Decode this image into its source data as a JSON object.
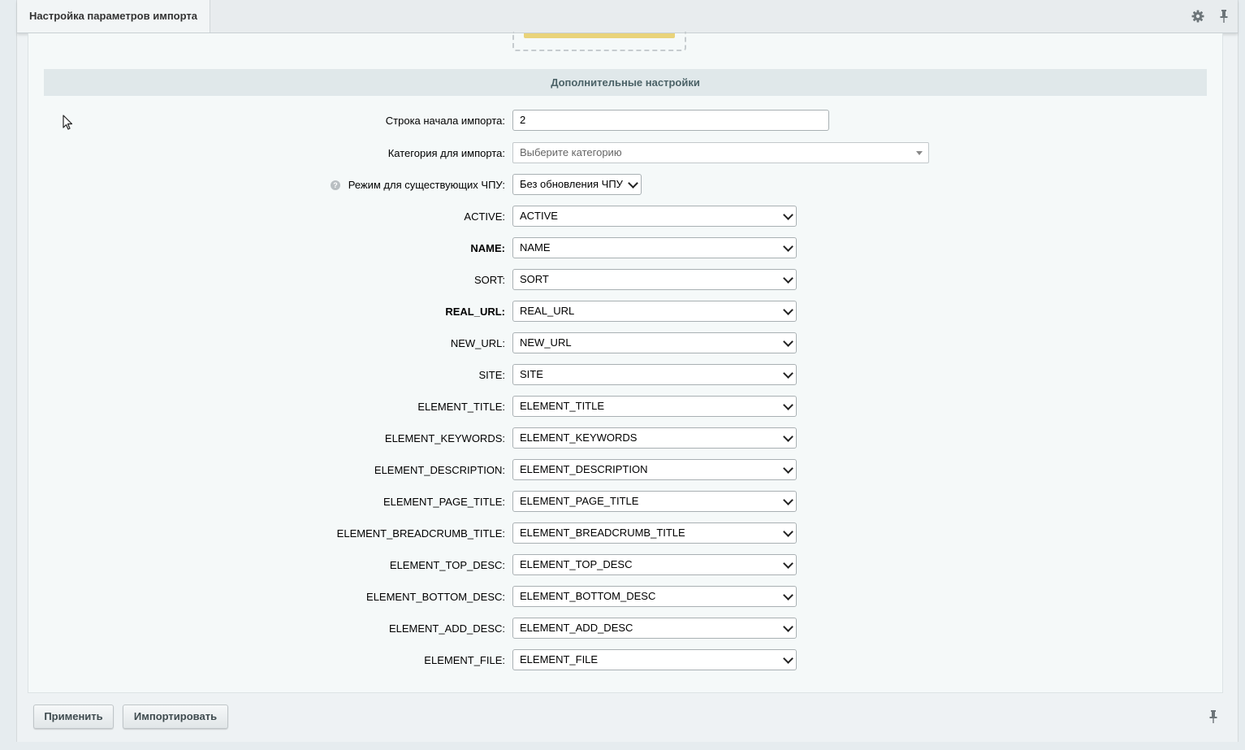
{
  "tab": {
    "title": "Настройка параметров импорта"
  },
  "section": {
    "heading": "Дополнительные настройки"
  },
  "form": {
    "start_row": {
      "label": "Строка начала импорта:",
      "value": "2"
    },
    "category": {
      "label": "Категория для импорта:",
      "placeholder": "Выберите категорию"
    },
    "url_mode": {
      "label": "Режим для существующих ЧПУ:",
      "value": "Без обновления ЧПУ",
      "help_glyph": "?"
    },
    "mappings": [
      {
        "label": "ACTIVE:",
        "value": "ACTIVE",
        "bold": false
      },
      {
        "label": "NAME:",
        "value": "NAME",
        "bold": true
      },
      {
        "label": "SORT:",
        "value": "SORT",
        "bold": false
      },
      {
        "label": "REAL_URL:",
        "value": "REAL_URL",
        "bold": true
      },
      {
        "label": "NEW_URL:",
        "value": "NEW_URL",
        "bold": false
      },
      {
        "label": "SITE:",
        "value": "SITE",
        "bold": false
      },
      {
        "label": "ELEMENT_TITLE:",
        "value": "ELEMENT_TITLE",
        "bold": false
      },
      {
        "label": "ELEMENT_KEYWORDS:",
        "value": "ELEMENT_KEYWORDS",
        "bold": false
      },
      {
        "label": "ELEMENT_DESCRIPTION:",
        "value": "ELEMENT_DESCRIPTION",
        "bold": false
      },
      {
        "label": "ELEMENT_PAGE_TITLE:",
        "value": "ELEMENT_PAGE_TITLE",
        "bold": false
      },
      {
        "label": "ELEMENT_BREADCRUMB_TITLE:",
        "value": "ELEMENT_BREADCRUMB_TITLE",
        "bold": false
      },
      {
        "label": "ELEMENT_TOP_DESC:",
        "value": "ELEMENT_TOP_DESC",
        "bold": false
      },
      {
        "label": "ELEMENT_BOTTOM_DESC:",
        "value": "ELEMENT_BOTTOM_DESC",
        "bold": false
      },
      {
        "label": "ELEMENT_ADD_DESC:",
        "value": "ELEMENT_ADD_DESC",
        "bold": false
      },
      {
        "label": "ELEMENT_FILE:",
        "value": "ELEMENT_FILE",
        "bold": false
      }
    ]
  },
  "footer": {
    "apply_label": "Применить",
    "import_label": "Импортировать"
  },
  "icons": {
    "settings": "gear-icon",
    "pin": "pin-icon",
    "help": "question-icon",
    "cursor": "mouse-cursor-icon"
  },
  "colors": {
    "background": "#e6ecef",
    "content": "#f5f9f9",
    "section_header": "#e0e8ea",
    "section_text": "#4b6267"
  }
}
